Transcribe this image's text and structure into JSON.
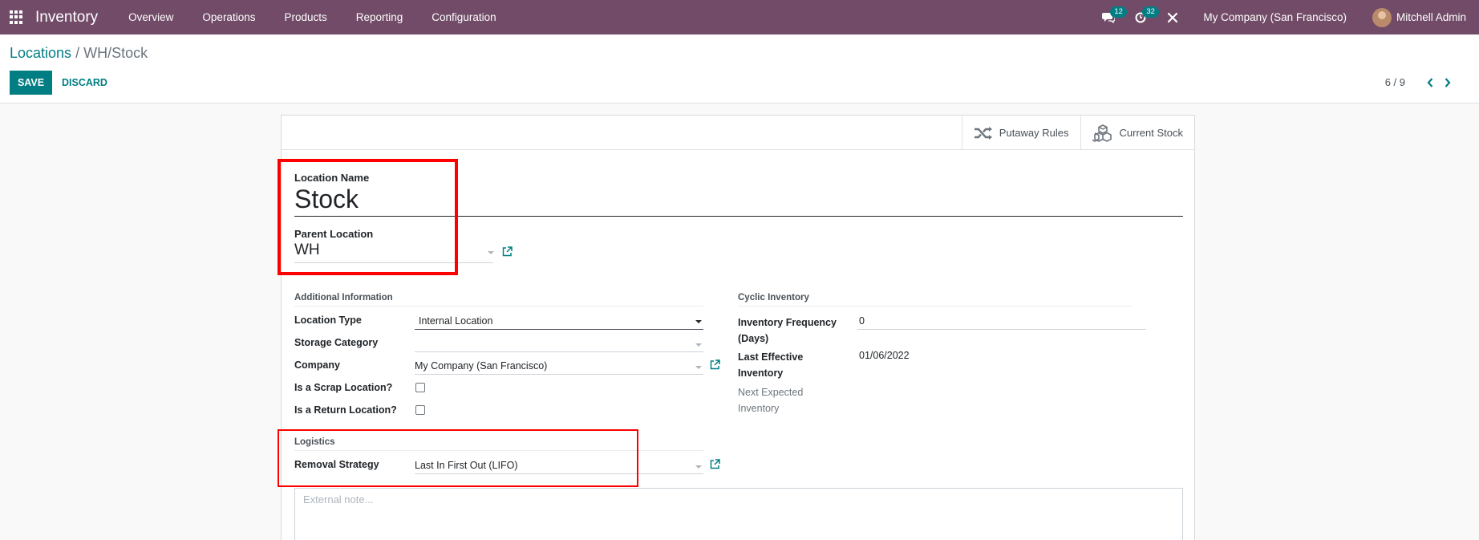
{
  "navbar": {
    "app_title": "Inventory",
    "menu": [
      "Overview",
      "Operations",
      "Products",
      "Reporting",
      "Configuration"
    ],
    "messages_count": "12",
    "activities_count": "32",
    "company": "My Company (San Francisco)",
    "user": "Mitchell Admin"
  },
  "breadcrumb": {
    "parent": "Locations",
    "separator": "/",
    "current": "WH/Stock"
  },
  "buttons": {
    "save": "SAVE",
    "discard": "DISCARD"
  },
  "pager": {
    "value": "6 / 9"
  },
  "smart_buttons": {
    "putaway_rules": "Putaway Rules",
    "current_stock": "Current Stock"
  },
  "form": {
    "location_name_label": "Location Name",
    "location_name": "Stock",
    "parent_location_label": "Parent Location",
    "parent_location": "WH",
    "additional_info": {
      "title": "Additional Information",
      "location_type_label": "Location Type",
      "location_type": "Internal Location",
      "storage_category_label": "Storage Category",
      "storage_category": "",
      "company_label": "Company",
      "company": "My Company (San Francisco)",
      "scrap_label": "Is a Scrap Location?",
      "return_label": "Is a Return Location?"
    },
    "cyclic_inventory": {
      "title": "Cyclic Inventory",
      "frequency_label_1": "Inventory Frequency",
      "frequency_label_2": "(Days)",
      "frequency": "0",
      "last_effective_label_1": "Last Effective",
      "last_effective_label_2": "Inventory",
      "last_effective": "01/06/2022",
      "next_expected_label_1": "Next Expected",
      "next_expected_label_2": "Inventory"
    },
    "logistics": {
      "title": "Logistics",
      "removal_strategy_label": "Removal Strategy",
      "removal_strategy": "Last In First Out (LIFO)"
    },
    "note_placeholder": "External note..."
  },
  "colors": {
    "navbar": "#714b67",
    "primary": "#017e84",
    "highlight": "#ff0000"
  }
}
